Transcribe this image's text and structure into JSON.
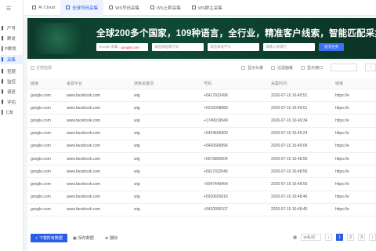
{
  "sidebar": {
    "logo": "☰",
    "items": [
      {
        "label": "▍ 产号",
        "active": false
      },
      {
        "label": "▍ 群发",
        "active": false
      },
      {
        "label": "▍P群发",
        "active": false
      },
      {
        "label": "▍ 采集",
        "active": true
      },
      {
        "label": "▍ 查题",
        "active": false
      },
      {
        "label": "▍ 监控",
        "active": false
      },
      {
        "label": "▍ 调查",
        "active": false
      },
      {
        "label": "▍ 评估",
        "active": false
      },
      {
        "label": "▍ C友",
        "active": false
      }
    ]
  },
  "tabs": [
    {
      "label": "AI Cloud",
      "active": false
    },
    {
      "label": "全球号码采集",
      "active": true
    },
    {
      "label": "WS号码采集",
      "active": false
    },
    {
      "label": "WS土群采集",
      "active": false
    },
    {
      "label": "WS群主采集",
      "active": false
    }
  ],
  "banner": {
    "title": "全球200多个国家，109种语言，全行业，精准客户线索，智能匹配采集",
    "search_engine_prefix": "Google 采集 :",
    "search_engine_value": "google.com",
    "field2_placeholder": "请选择国家代号",
    "field3_placeholder": "请选择关字头",
    "field4_placeholder": "请输入关键行",
    "search_button": "提交任务"
  },
  "toolbar": {
    "select_all": "全部选择",
    "opt1": "显示头像",
    "opt2": "过滤面板",
    "opt3": "显示接口",
    "select_value": "",
    "select2_value": "↑"
  },
  "table": {
    "headers": [
      "链接",
      "来源平台",
      "搜索关键词",
      "号码",
      "采集时间",
      "链接"
    ],
    "rows": [
      [
        "google.com",
        "www.facebook.com",
        "wig",
        "+5417922498",
        "2026-07-10 16:49:51",
        "https://e"
      ],
      [
        "google.com",
        "www.facebook.com",
        "wig",
        "+5216008089",
        "2026-07-10 16:49:51",
        "https://e"
      ],
      [
        "google.com",
        "www.facebook.com",
        "wig",
        "+1749019549",
        "2026-07-10 16:49:34",
        "https://e"
      ],
      [
        "google.com",
        "www.facebook.com",
        "wig",
        "+5424665600",
        "2026-07-10 16:49:24",
        "https://e"
      ],
      [
        "google.com",
        "www.facebook.com",
        "wig",
        "+5426666896",
        "2026-07-10 16:49:06",
        "https://e"
      ],
      [
        "google.com",
        "www.facebook.com",
        "wig",
        "+5579800004",
        "2026-07-10 16:48:56",
        "https://e"
      ],
      [
        "google.com",
        "www.facebook.com",
        "wig",
        "+5917022046",
        "2026-07-10 16:48:56",
        "https://e"
      ],
      [
        "google.com",
        "www.facebook.com",
        "wig",
        "+5047449454",
        "2026-07-10 16:48:56",
        "https://e"
      ],
      [
        "google.com",
        "www.facebook.com",
        "wig",
        "+5910655616",
        "2026-07-10 16:48:46",
        "https://e"
      ],
      [
        "google.com",
        "www.facebook.com",
        "wig",
        "+5410055107",
        "2026-07-10 16:48:45",
        "https://e"
      ]
    ]
  },
  "footer": {
    "export_button": "下载所有数据",
    "save_button": "保存数据",
    "delete_button": "删除",
    "page_size": "10条/页",
    "pages": [
      "1",
      "2",
      "3"
    ],
    "active_page": "1",
    "prev": "‹",
    "next": "›"
  },
  "colors": {
    "accent": "#2b5ce6",
    "banner_bg": "#0f4a36"
  }
}
